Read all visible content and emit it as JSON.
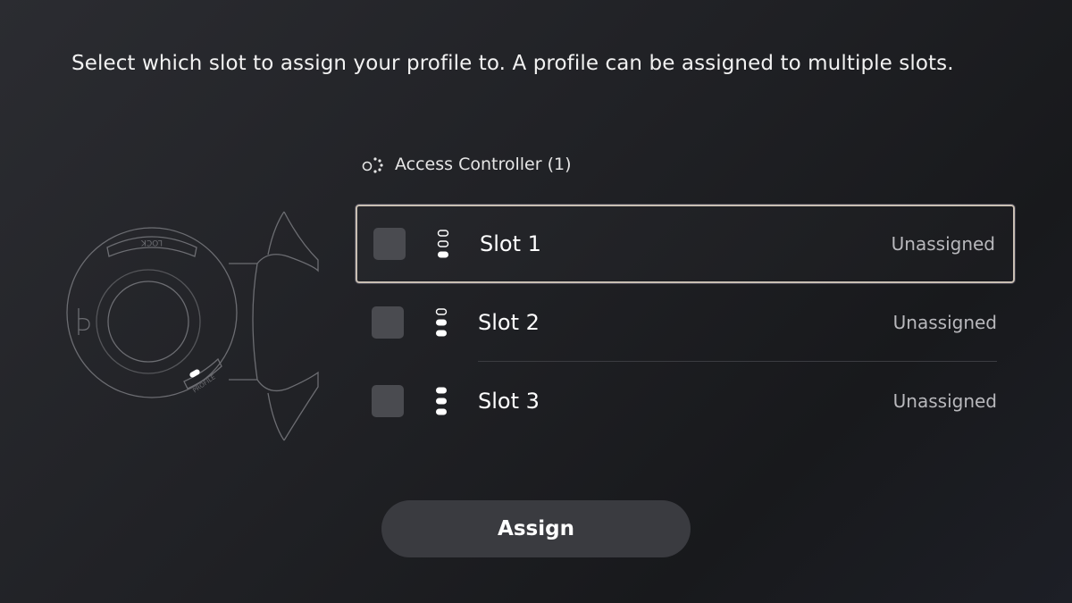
{
  "instruction": "Select which slot to assign your profile to. A profile can be assigned to multiple slots.",
  "device": {
    "icon": "access-controller-icon",
    "name": "Access Controller (1)"
  },
  "illustration": {
    "lock_label": "LOCK",
    "profile_label": "PROFILE"
  },
  "slots": [
    {
      "label": "Slot 1",
      "status": "Unassigned",
      "checked": false,
      "focused": true,
      "icon": "slot-1-indicator-icon"
    },
    {
      "label": "Slot 2",
      "status": "Unassigned",
      "checked": false,
      "focused": false,
      "icon": "slot-2-indicator-icon"
    },
    {
      "label": "Slot 3",
      "status": "Unassigned",
      "checked": false,
      "focused": false,
      "icon": "slot-3-indicator-icon"
    }
  ],
  "assign_button": {
    "label": "Assign"
  },
  "colors": {
    "focus_border": "#c9bfb3",
    "checkbox_fill": "#4a4b50",
    "button_fill": "#3a3b40"
  }
}
